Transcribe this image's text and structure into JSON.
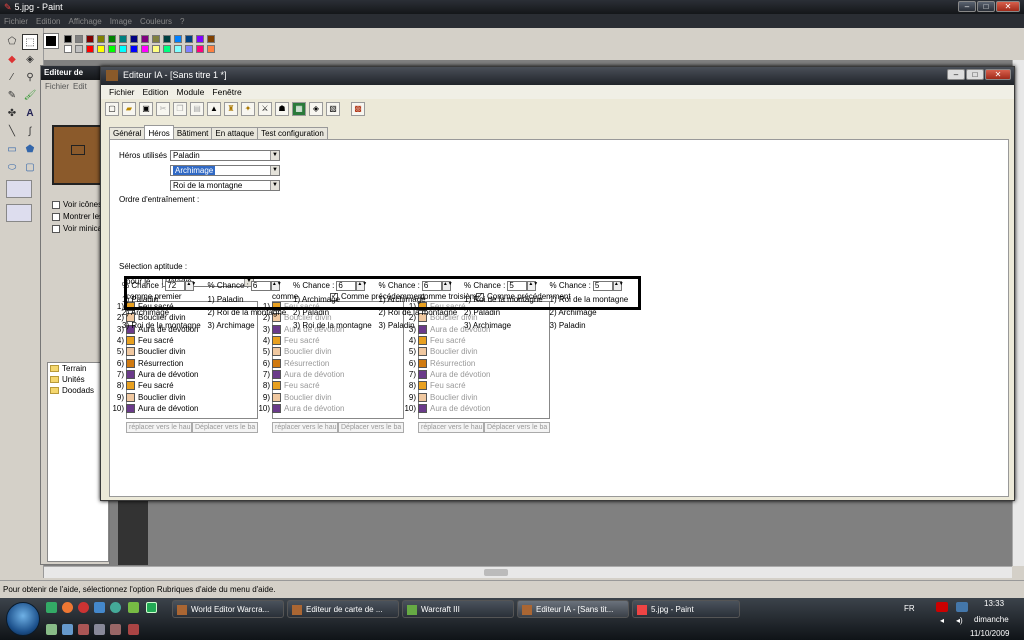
{
  "paint": {
    "title": "5.jpg - Paint",
    "menu": [
      "Fichier",
      "Edition",
      "Affichage",
      "Image",
      "Couleurs",
      "?"
    ],
    "status": "Pour obtenir de l'aide, sélectionnez l'option Rubriques d'aide du menu d'aide.",
    "palette": [
      "#000000",
      "#808080",
      "#800000",
      "#808000",
      "#008000",
      "#008080",
      "#000080",
      "#800080",
      "#808040",
      "#004040",
      "#0080ff",
      "#004080",
      "#8000ff",
      "#804000",
      "#ffffff",
      "#c0c0c0",
      "#ff0000",
      "#ffff00",
      "#00ff00",
      "#00ffff",
      "#0000ff",
      "#ff00ff",
      "#ffff80",
      "#00ff80",
      "#80ffff",
      "#8080ff",
      "#ff0080",
      "#ff8040"
    ]
  },
  "world_editor": {
    "title": "Editeur de",
    "menu": [
      "Fichier",
      "Edit"
    ],
    "checks": [
      "Voir icônes",
      "Montrer les",
      "Voir minica"
    ],
    "tree": [
      "Terrain",
      "Unités",
      "Doodads"
    ]
  },
  "ia": {
    "title": "Editeur IA - [Sans titre 1 *]",
    "menu": [
      "Fichier",
      "Edition",
      "Module",
      "Fenêtre"
    ],
    "tabs": [
      "Général",
      "Héros",
      "Bâtiment",
      "En attaque",
      "Test configuration"
    ],
    "heroes_label": "Héros utilisés :",
    "heroes": [
      "Paladin",
      "Archimage",
      "Roi de la montagne"
    ],
    "order_label": "Ordre d'entraînement :",
    "chance_label": "% Chance :",
    "columns": [
      {
        "chance": "72",
        "items": [
          "1) Paladin",
          "2) Archimage",
          "3) Roi de la montagne"
        ]
      },
      {
        "chance": "6",
        "items": [
          "1) Paladin",
          "2) Roi de la montagne",
          "3) Archimage"
        ]
      },
      {
        "chance": "6",
        "items": [
          "1) Archimage",
          "2) Paladin",
          "3) Roi de la montagne"
        ]
      },
      {
        "chance": "6",
        "items": [
          "1) Archimage",
          "2) Roi de la montagne",
          "3) Paladin"
        ]
      },
      {
        "chance": "5",
        "items": [
          "1) Roi de la montagne",
          "2) Paladin",
          "3) Archimage"
        ]
      },
      {
        "chance": "5",
        "items": [
          "1) Roi de la montagne",
          "2) Archimage",
          "3) Paladin"
        ]
      }
    ],
    "ability_label": "Sélection aptitude :",
    "for_label": "pour le",
    "for_value": "Paladin",
    "list_headers": [
      "comme premier",
      "comme",
      "comme troisième"
    ],
    "same_as_prev": "Comme précédemment",
    "abilities": [
      {
        "n": "1)",
        "name": "Feu sacré",
        "icon": "fire"
      },
      {
        "n": "2)",
        "name": "Bouclier divin",
        "icon": "shield"
      },
      {
        "n": "3)",
        "name": "Aura de dévotion",
        "icon": "aura"
      },
      {
        "n": "4)",
        "name": "Feu sacré",
        "icon": "fire"
      },
      {
        "n": "5)",
        "name": "Bouclier divin",
        "icon": "shield"
      },
      {
        "n": "6)",
        "name": "Résurrection",
        "icon": "res"
      },
      {
        "n": "7)",
        "name": "Aura de dévotion",
        "icon": "aura"
      },
      {
        "n": "8)",
        "name": "Feu sacré",
        "icon": "fire"
      },
      {
        "n": "9)",
        "name": "Bouclier divin",
        "icon": "shield"
      },
      {
        "n": "10)",
        "name": "Aura de dévotion",
        "icon": "aura"
      }
    ],
    "move_up": "réplacer vers le hau",
    "move_down": "Déplacer vers le ba"
  },
  "taskbar": {
    "tasks": [
      "World Editor Warcra...",
      "Editeur de carte de ...",
      "Warcraft III",
      "Editeur IA - [Sans tit...",
      "5.jpg - Paint"
    ],
    "lang": "FR",
    "time": "13:33",
    "day": "dimanche",
    "date": "11/10/2009"
  },
  "colors": {
    "fire": "#e8a020",
    "shield": "#f0c8a0",
    "aura": "#6a3a8a",
    "res": "#d07a10"
  }
}
